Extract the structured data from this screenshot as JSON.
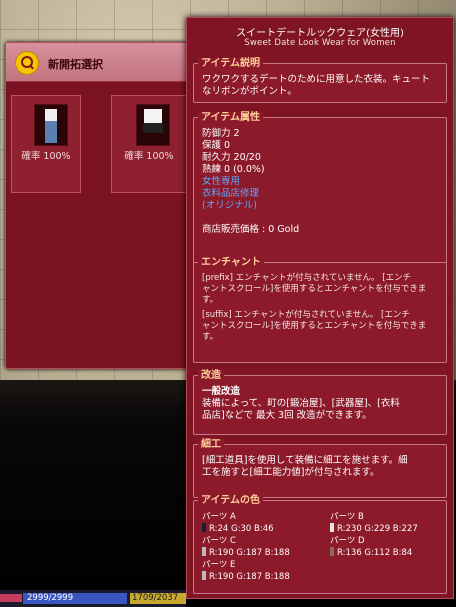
{
  "left_window": {
    "title": "新開拓選択",
    "items": [
      {
        "rate": "確率 100%"
      },
      {
        "rate": "確率 100%"
      }
    ]
  },
  "tooltip": {
    "title": "スイートデートルックウェア(女性用)",
    "subtitle": "Sweet Date Look Wear for Women",
    "desc_label": "アイテム説明",
    "desc_text_1": "ワクワクするデートのために用意した衣装。キュート",
    "desc_text_2": "なリボンがポイント。",
    "attr_label": "アイテム属性",
    "attr_defense": "防御力 2",
    "attr_protect": "保護 0",
    "attr_durability": "耐久力 20/20",
    "attr_mastery": "熟練 0 (0.0%)",
    "attr_female": "女性専用",
    "attr_repair": "衣料品店修理",
    "attr_original": "(オリジナル)",
    "attr_price": "商店販売価格 : 0 Gold",
    "enchant_label": "エンチャント",
    "enchant_prefix_1": "[prefix] エンチャントが付与されていません。 [エンチ",
    "enchant_prefix_2": "ャントスクロール]を使用するとエンチャントを付与できま",
    "enchant_prefix_3": "す。",
    "enchant_suffix_1": "[suffix] エンチャントが付与されていません。 [エンチ",
    "enchant_suffix_2": "ャントスクロール]を使用するとエンチャントを付与できま",
    "enchant_suffix_3": "す。",
    "modify_label": "改造",
    "modify_heading": "一般改造",
    "modify_text_1": "装備によって、町の[鍛冶屋]、[武器屋]、[衣料",
    "modify_text_2": "品店]などで 最大 3回 改造ができます。",
    "craft_label": "細工",
    "craft_text_1": "[細工道具]を使用して装備に細工を施せます。細",
    "craft_text_2": "工を施すと[細工能力値]が付与されます。",
    "color_label": "アイテムの色",
    "parts": [
      {
        "name": "パーツ A",
        "value": "R:24 G:30 B:46",
        "color": "#181e2e"
      },
      {
        "name": "パーツ B",
        "value": "R:230 G:229 B:227",
        "color": "#e6e5e3"
      },
      {
        "name": "パーツ C",
        "value": "R:190 G:187 B:188",
        "color": "#bebbbc"
      },
      {
        "name": "パーツ D",
        "value": "R:136 G:112 B:84",
        "color": "#887054"
      },
      {
        "name": "パーツ E",
        "value": "R:190 G:187 B:188",
        "color": "#bebbbc"
      }
    ]
  },
  "status": {
    "mp": "2999/2999",
    "sp": "1709/2037"
  }
}
